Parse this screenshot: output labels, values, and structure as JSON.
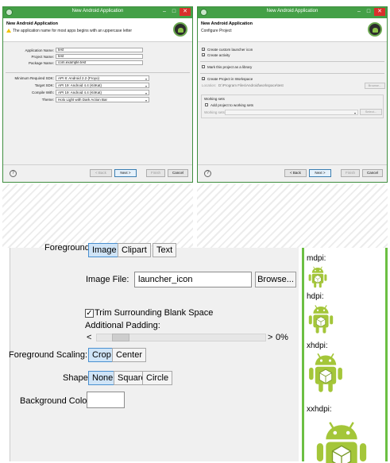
{
  "wizard1": {
    "window_title": "New Android Application",
    "header_title": "New Android Application",
    "header_message": "The application name for most apps begins with an uppercase letter",
    "application_name_label": "Application Name:",
    "application_name_value": "test",
    "project_name_label": "Project Name:",
    "project_name_value": "test",
    "package_name_label": "Package Name:",
    "package_name_value": "com.example.test",
    "min_sdk_label": "Minimum Required SDK:",
    "min_sdk_value": "API 8: Android 2.2 (Froyo)",
    "target_sdk_label": "Target SDK:",
    "target_sdk_value": "API 19: Android 4.4 (KitKat)",
    "compile_with_label": "Compile With:",
    "compile_with_value": "API 19: Android 4.4 (KitKat)",
    "theme_label": "Theme:",
    "theme_value": "Holo Light with Dark Action Bar",
    "back_label": "< Back",
    "next_label": "Next >",
    "finish_label": "Finish",
    "cancel_label": "Cancel"
  },
  "wizard2": {
    "window_title": "New Android Application",
    "header_title": "New Android Application",
    "header_subtitle": "Configure Project",
    "opt_custom_icon": "Create custom launcher icon",
    "opt_create_activity": "Create activity",
    "opt_mark_library": "Mark this project as a library",
    "opt_create_in_workspace": "Create Project in Workspace",
    "location_label": "Location:",
    "location_value": "D:\\Program Files\\Android\\workspace\\test",
    "browse_label": "Browse...",
    "working_sets_title": "Working sets",
    "add_to_working_sets": "Add project to working sets",
    "working_sets_label": "Working sets:",
    "select_label": "Select...",
    "back_label": "< Back",
    "next_label": "Next >",
    "finish_label": "Finish",
    "cancel_label": "Cancel"
  },
  "icon_panel": {
    "foreground_label": "Foreground:",
    "foreground_options": [
      "Image",
      "Clipart",
      "Text"
    ],
    "image_file_label": "Image File:",
    "image_file_value": "launcher_icon",
    "browse_label": "Browse...",
    "trim_label": "Trim Surrounding Blank Space",
    "padding_label": "Additional Padding:",
    "slider_left": "<",
    "slider_right": ">",
    "padding_value": "0%",
    "padding_fraction": 0,
    "scaling_label": "Foreground Scaling:",
    "scaling_options": [
      "Crop",
      "Center"
    ],
    "shape_label": "Shape",
    "shape_options": [
      "None",
      "Square",
      "Circle"
    ],
    "background_color_label": "Background Color:",
    "background_color_value": "#ffffff"
  },
  "preview": {
    "densities": [
      "mdpi:",
      "hdpi:",
      "xhdpi:",
      "xxhdpi:"
    ]
  },
  "colors": {
    "android_green": "#a4c639",
    "titlebar_green": "#44a047",
    "selected_blue": "#cfe4f7"
  }
}
